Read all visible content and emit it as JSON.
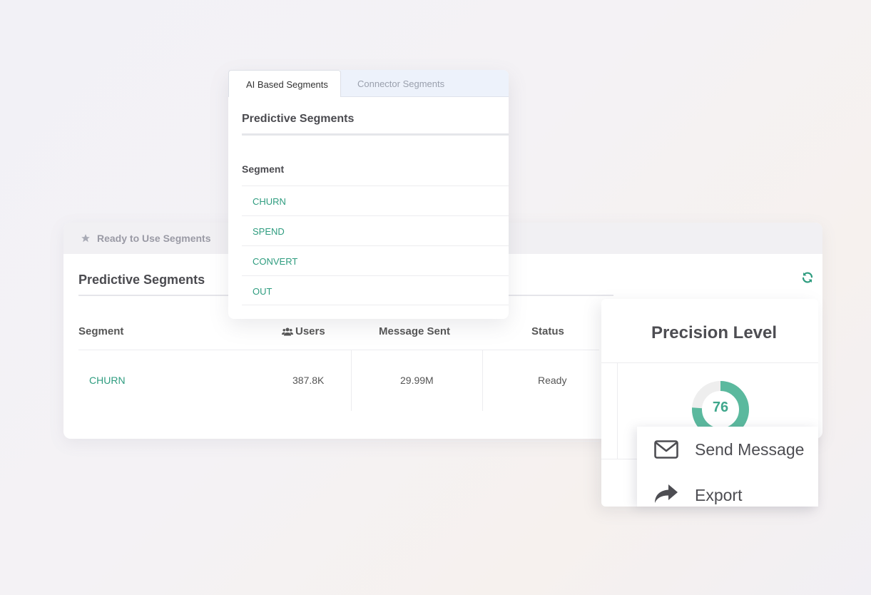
{
  "ready_panel": {
    "tab_label": "Ready to Use Segments",
    "title": "Predictive Segments",
    "columns": {
      "segment": "Segment",
      "users": "Users",
      "message_sent": "Message Sent",
      "status": "Status"
    },
    "row": {
      "segment": "CHURN",
      "users": "387.8K",
      "message_sent": "29.99M",
      "status": "Ready"
    }
  },
  "precision": {
    "title": "Precision Level",
    "value": "76",
    "level_fraction": 0.76
  },
  "action_menu": {
    "items": [
      {
        "label": "Send Message",
        "icon": "envelope-icon"
      },
      {
        "label": "Export",
        "icon": "share-arrow-icon"
      }
    ]
  },
  "segments_popup": {
    "tabs": [
      {
        "label": "AI Based Segments",
        "active": true
      },
      {
        "label": "Connector Segments",
        "active": false
      }
    ],
    "title": "Predictive Segments",
    "column_header": "Segment",
    "segments": [
      "CHURN",
      "SPEND",
      "CONVERT",
      "OUT"
    ]
  },
  "colors": {
    "accent": "#2e9c7f",
    "donut_fill": "#5bb99e",
    "donut_track": "#eeeeee"
  }
}
